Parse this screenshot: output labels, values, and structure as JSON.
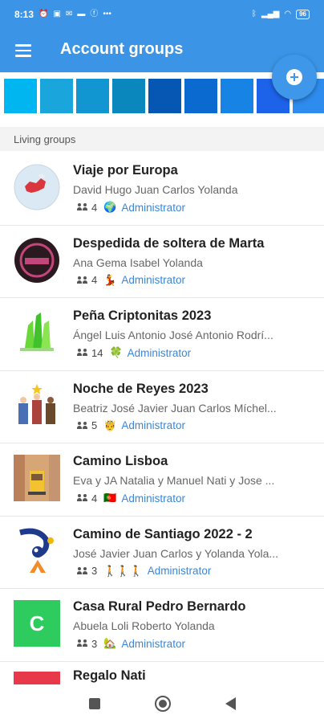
{
  "status_bar": {
    "time": "8:13",
    "left_icons": [
      "alarm-icon",
      "app-icon",
      "mail-icon",
      "message-icon",
      "facebook-icon",
      "more-dots-icon"
    ],
    "right_icons": [
      "bluetooth-icon",
      "signal-icon",
      "wifi-icon"
    ],
    "battery": "96"
  },
  "app_bar": {
    "title": "Account groups"
  },
  "color_tiles": [
    "#00b6f0",
    "#1aa6dd",
    "#1196d2",
    "#0a87bd",
    "#0657b3",
    "#0b6acf",
    "#1783e4",
    "#1d63ea",
    "#2d8cee"
  ],
  "section": {
    "title": "Living groups"
  },
  "groups": [
    {
      "name": "Viaje por Europa",
      "members": "David Hugo Juan Carlos Yolanda",
      "count": "4",
      "emoji": "🌍",
      "role": "Administrator",
      "avatar": "europe-globe-image"
    },
    {
      "name": "Despedida de soltera de Marta",
      "members": "Ana Gema Isabel Yolanda",
      "count": "4",
      "emoji": "💃",
      "role": "Administrator",
      "avatar": "party-logo-image"
    },
    {
      "name": "Peña Criptonitas 2023",
      "members": "Ángel Luis Antonio José Antonio Rodrí...",
      "count": "14",
      "emoji": "🍀",
      "role": "Administrator",
      "avatar": "green-crystal-image"
    },
    {
      "name": "Noche de Reyes 2023",
      "members": "Beatriz José Javier Juan Carlos Míchel...",
      "count": "5",
      "emoji": "🤴",
      "role": "Administrator",
      "avatar": "three-kings-image"
    },
    {
      "name": "Camino Lisboa",
      "members": "Eva y JA Natalia y Manuel Nati y Jose ...",
      "count": "4",
      "emoji": "🇵🇹",
      "role": "Administrator",
      "avatar": "lisbon-tram-image"
    },
    {
      "name": "Camino de Santiago 2022 - 2",
      "members": "José Javier Juan Carlos y Yolanda Yola...",
      "count": "3",
      "emoji": "🚶🚶🚶",
      "role": "Administrator",
      "avatar": "camino-logo-image"
    },
    {
      "name": "Casa Rural Pedro Bernardo",
      "members": "Abuela Loli Roberto Yolanda",
      "count": "3",
      "emoji": "🏡",
      "role": "Administrator",
      "avatar": "letter-c-avatar",
      "avatar_letter": "C",
      "avatar_color": "#2ecc5e"
    },
    {
      "name": "Regalo Nati",
      "members": "",
      "count": "",
      "emoji": "",
      "role": "",
      "avatar": "red-avatar",
      "avatar_color": "#e8394a"
    }
  ]
}
